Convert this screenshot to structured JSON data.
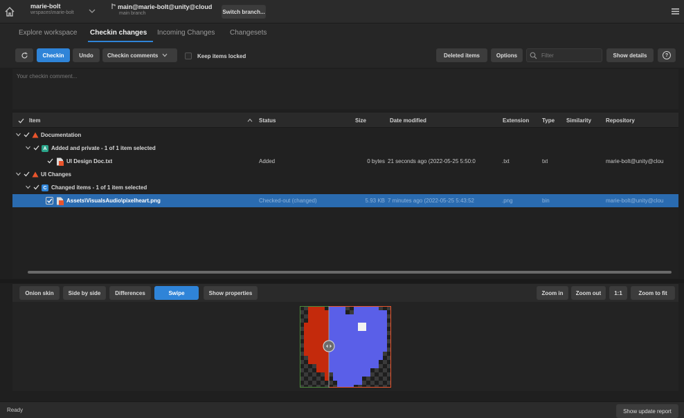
{
  "header": {
    "workspace_name": "marie-bolt",
    "workspace_path": "wrspaces\\marie-bolt",
    "branch_title": "main@marie-bolt@unity@cloud",
    "branch_sub": "main branch",
    "switch_branch_label": "Switch branch..."
  },
  "tabs": [
    {
      "label": "Explore workspace"
    },
    {
      "label": "Checkin changes"
    },
    {
      "label": "Incoming Changes"
    },
    {
      "label": "Changesets"
    }
  ],
  "active_tab": "Checkin changes",
  "toolbar": {
    "checkin_label": "Checkin",
    "undo_label": "Undo",
    "checkin_comments_label": "Checkin comments",
    "keep_locked_label": "Keep items locked",
    "deleted_items_label": "Deleted items",
    "options_label": "Options",
    "filter_placeholder": "Filter",
    "show_details_label": "Show details",
    "help_label": "?"
  },
  "comment": {
    "placeholder": "Your checkin comment..."
  },
  "table": {
    "columns": {
      "item": "Item",
      "status": "Status",
      "size": "Size",
      "date": "Date modified",
      "extension": "Extension",
      "type": "Type",
      "similarity": "Similarity",
      "repository": "Repository"
    },
    "rows": [
      {
        "item": "Documentation"
      },
      {
        "item": "Added and private - 1 of 1 item selected"
      },
      {
        "item": "UI Design Doc.txt",
        "status": "Added",
        "size": "0 bytes",
        "date": "21 seconds ago (2022-05-25 5:50:0",
        "extension": ".txt",
        "type": "txt",
        "repository": "marie-bolt@unity@clou"
      },
      {
        "item": "UI Changes"
      },
      {
        "item": "Changed items - 1 of 1 item selected"
      },
      {
        "item": "Assets\\VisualsAudio\\pixelheart.png",
        "status": "Checked-out (changed)",
        "size": "5.93 KB",
        "date": "7 minutes ago (2022-05-25 5:43:52",
        "extension": ".png",
        "type": "bin",
        "repository": "marie-bolt@unity@clou"
      }
    ]
  },
  "diff_toolbar": {
    "onion_skin": "Onion skin",
    "side_by_side": "Side by side",
    "differences": "Differences",
    "swipe": "Swipe",
    "show_properties": "Show properties",
    "zoom_in": "Zoom in",
    "zoom_out": "Zoom out",
    "one_to_one": "1:1",
    "zoom_to_fit": "Zoom to fit"
  },
  "status": {
    "text": "Ready",
    "show_update_report": "Show update report"
  },
  "colors": {
    "accent": "#2f84d8",
    "added_icon": "#2aa58a",
    "changed_icon": "#2f84d8",
    "warning_icon": "#e8542c"
  }
}
